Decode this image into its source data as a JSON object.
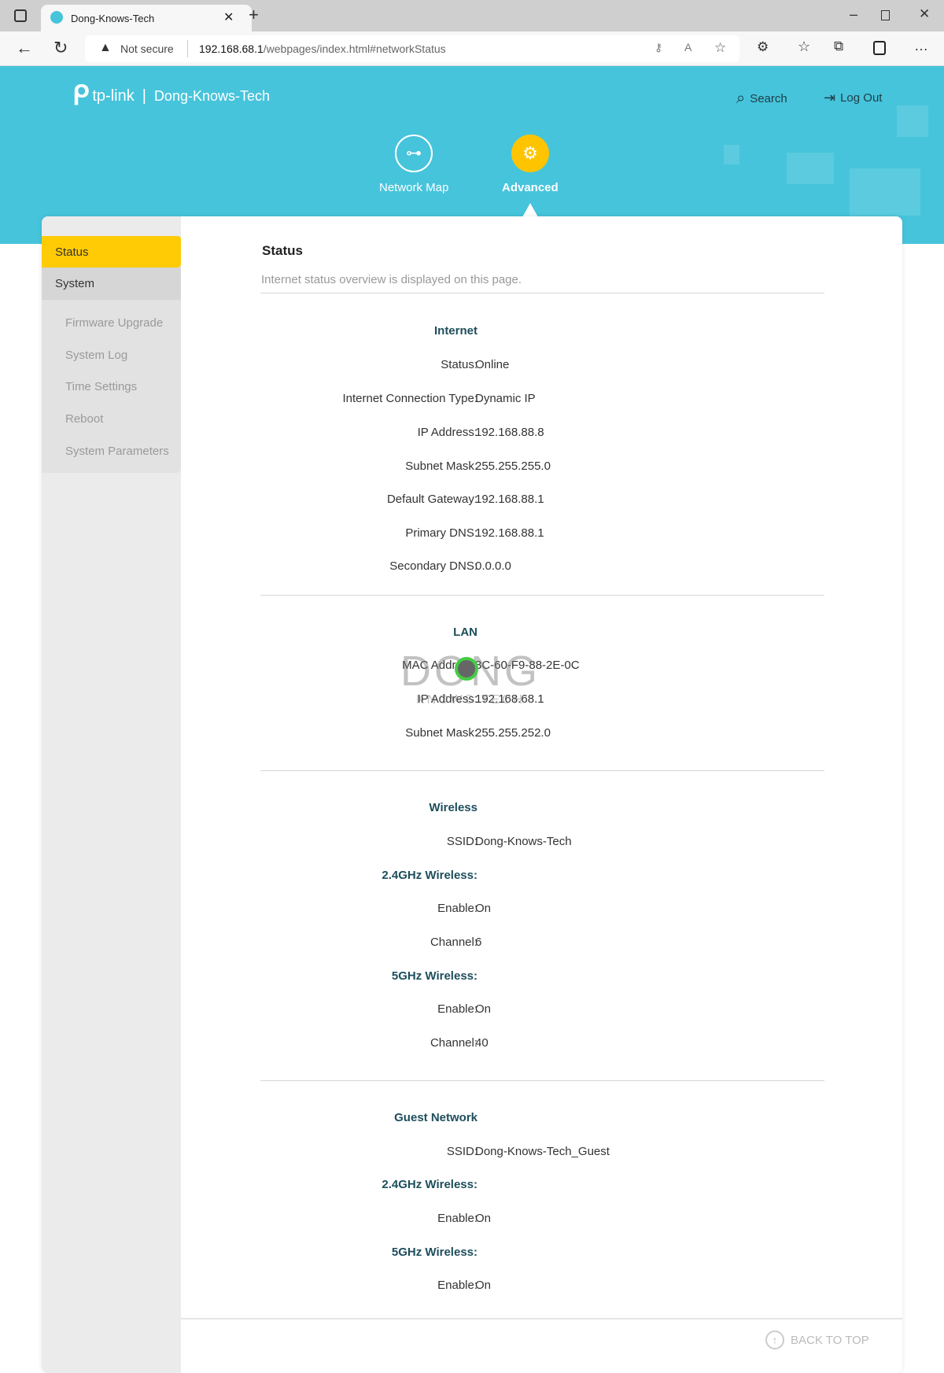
{
  "browser": {
    "tab_title": "Dong-Knows-Tech",
    "not_secure": "Not secure",
    "url_host": "192.168.68.1",
    "url_path": "/webpages/index.html#networkStatus"
  },
  "header": {
    "brand": "tp-link",
    "device_name": "Dong-Knows-Tech",
    "search": "Search",
    "logout": "Log Out",
    "accent": "#46c4db",
    "active_color": "#ffc400"
  },
  "nav": [
    {
      "label": "Network Map",
      "icon": "network-map-icon"
    },
    {
      "label": "Advanced",
      "icon": "gear-icon",
      "active": true
    }
  ],
  "sidebar": {
    "items": [
      {
        "label": "Status",
        "active": true
      },
      {
        "label": "System"
      }
    ],
    "subitems": [
      "Firmware Upgrade",
      "System Log",
      "Time Settings",
      "Reboot",
      "System Parameters"
    ]
  },
  "content": {
    "title": "Status",
    "description": "Internet status overview is displayed on this page.",
    "internet": {
      "heading": "Internet",
      "rows": [
        [
          "Status:",
          "Online"
        ],
        [
          "Internet Connection Type:",
          "Dynamic IP"
        ],
        [
          "IP Address:",
          "192.168.88.8"
        ],
        [
          "Subnet Mask:",
          "255.255.255.0"
        ],
        [
          "Default Gateway:",
          "192.168.88.1"
        ],
        [
          "Primary DNS:",
          "192.168.88.1"
        ],
        [
          "Secondary DNS:",
          "0.0.0.0"
        ]
      ]
    },
    "lan": {
      "heading": "LAN",
      "rows": [
        [
          "MAC Address:",
          "3C-60-F9-88-2E-0C"
        ],
        [
          "IP Address:",
          "192.168.68.1"
        ],
        [
          "Subnet Mask:",
          "255.255.252.0"
        ]
      ]
    },
    "wireless": {
      "heading": "Wireless",
      "ssid": [
        "SSID:",
        "Dong-Knows-Tech"
      ],
      "band24": "2.4GHz Wireless:",
      "enable24": [
        "Enable:",
        "On"
      ],
      "channel24": [
        "Channel:",
        "6"
      ],
      "band5": "5GHz Wireless:",
      "enable5": [
        "Enable:",
        "On"
      ],
      "channel5": [
        "Channel:",
        "40"
      ]
    },
    "guest": {
      "heading": "Guest Network",
      "ssid": [
        "SSID:",
        "Dong-Knows-Tech_Guest"
      ],
      "band24": "2.4GHz Wireless:",
      "enable24": [
        "Enable:",
        "On"
      ],
      "band5": "5GHz Wireless:",
      "enable5": [
        "Enable:",
        "On"
      ]
    }
  },
  "footer": {
    "back_to_top": "BACK TO TOP"
  },
  "watermark": "DONG KNOWS TECH"
}
